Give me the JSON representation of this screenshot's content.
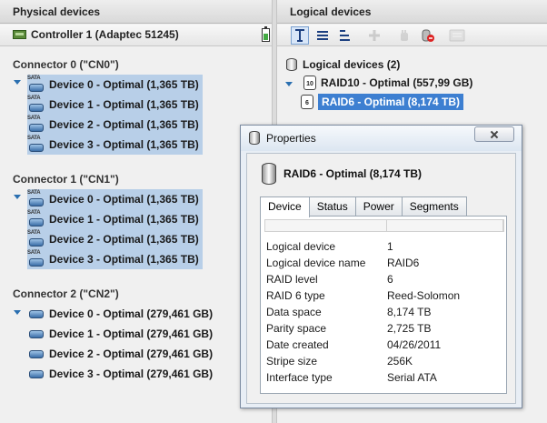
{
  "left_panel": {
    "title": "Physical devices",
    "controller": "Controller 1 (Adaptec 51245)",
    "connectors": [
      {
        "title": "Connector 0 (\"CN0\")",
        "devices": [
          "Device 0 - Optimal (1,365 TB)",
          "Device 1 - Optimal (1,365 TB)",
          "Device 2 - Optimal (1,365 TB)",
          "Device 3 - Optimal (1,365 TB)"
        ]
      },
      {
        "title": "Connector 1 (\"CN1\")",
        "devices": [
          "Device 0 - Optimal (1,365 TB)",
          "Device 1 - Optimal (1,365 TB)",
          "Device 2 - Optimal (1,365 TB)",
          "Device 3 - Optimal (1,365 TB)"
        ]
      },
      {
        "title": "Connector 2 (\"CN2\")",
        "devices": [
          "Device 0 - Optimal (279,461 GB)",
          "Device 1 - Optimal (279,461 GB)",
          "Device 2 - Optimal (279,461 GB)",
          "Device 3 - Optimal (279,461 GB)"
        ]
      }
    ],
    "sata_tag": "SATA"
  },
  "right_panel": {
    "title": "Logical devices",
    "root": "Logical devices (2)",
    "items": [
      {
        "label": "RAID10 - Optimal (557,99 GB)",
        "icon_text": "10"
      },
      {
        "label": "RAID6 - Optimal (8,174 TB)",
        "icon_text": "6"
      }
    ]
  },
  "dialog": {
    "title": "Properties",
    "heading": "RAID6 - Optimal (8,174 TB)",
    "tabs": [
      "Device",
      "Status",
      "Power",
      "Segments"
    ],
    "active_tab": "Device",
    "properties": [
      {
        "key": "Logical device",
        "value": "1"
      },
      {
        "key": "Logical device name",
        "value": "RAID6"
      },
      {
        "key": "RAID level",
        "value": "6"
      },
      {
        "key": "RAID 6 type",
        "value": "Reed-Solomon"
      },
      {
        "key": "Data space",
        "value": "8,174 TB"
      },
      {
        "key": "Parity space",
        "value": "2,725 TB"
      },
      {
        "key": "Date created",
        "value": "04/26/2011"
      },
      {
        "key": "Stripe size",
        "value": "256K"
      },
      {
        "key": "Interface type",
        "value": "Serial ATA"
      }
    ]
  },
  "colors": {
    "selection_light": "#b8cfe8",
    "selection_dark": "#3d7fd1",
    "toggle": "#2a6fb0"
  }
}
